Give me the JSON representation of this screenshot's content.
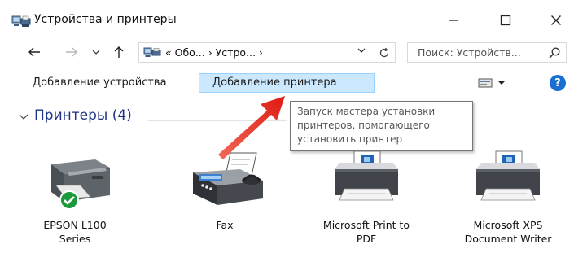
{
  "window": {
    "title": "Устройства и принтеры"
  },
  "address_bar": {
    "path": "«  Обо...  ›  Устро...  ›",
    "search_placeholder": "Поиск: Устройств..."
  },
  "command_bar": {
    "add_device_label": "Добавление устройства",
    "add_printer_label": "Добавление принтера"
  },
  "group": {
    "title": "Принтеры (4)"
  },
  "tooltip": {
    "text": "Запуск мастера установки\nпринтеров, помогающего\nустановить принтер"
  },
  "devices": [
    {
      "label": "EPSON L100\nSeries",
      "icon": "inkjet-printer-default-icon",
      "is_default": true
    },
    {
      "label": "Fax",
      "icon": "fax-icon",
      "is_default": false
    },
    {
      "label": "Microsoft Print to\nPDF",
      "icon": "printer-icon",
      "is_default": false
    },
    {
      "label": "Microsoft XPS\nDocument Writer",
      "icon": "printer-icon",
      "is_default": false
    }
  ],
  "colors": {
    "accent_selection": "#cce8ff",
    "selection_border": "#99d1ff",
    "group_header": "#1e3287",
    "help_icon": "#1b6fd0",
    "default_badge": "#1a9a3a",
    "annotation_arrow": "#e8201a"
  }
}
